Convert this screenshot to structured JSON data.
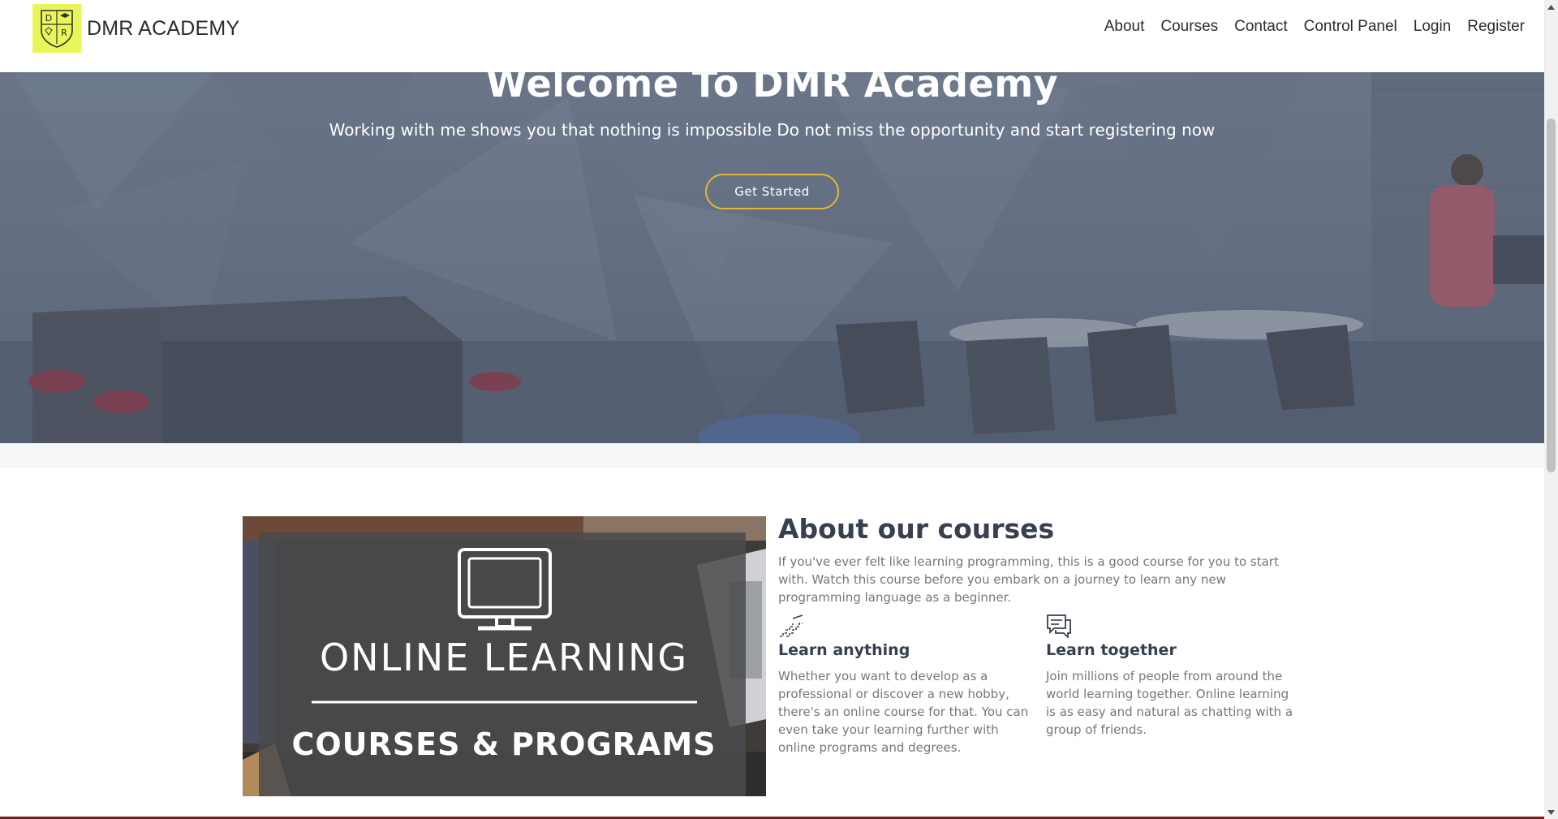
{
  "brand": {
    "name": "DMR ACADEMY",
    "logo_letters": [
      "D",
      "R",
      "A"
    ],
    "logo_caption": "DMR ACADEMY",
    "logo_bg": "#e8f65a"
  },
  "nav": {
    "items": [
      {
        "label": "About"
      },
      {
        "label": "Courses"
      },
      {
        "label": "Contact"
      },
      {
        "label": "Control Panel"
      },
      {
        "label": "Login"
      },
      {
        "label": "Register"
      }
    ]
  },
  "hero": {
    "title": "Welcome To DMR Academy",
    "subtitle": "Working with me shows you that nothing is impossible Do not miss the opportunity and start registering now",
    "button_label": "Get Started",
    "button_border_color": "#e5b732"
  },
  "about": {
    "image": {
      "line1": "ONLINE LEARNING",
      "line2": "COURSES & PROGRAMS",
      "icon": "monitor-icon"
    },
    "title": "About our courses",
    "description": "If you've ever felt like learning programming, this is a good course for you to start with. Watch this course before you embark on a journey to learn any new programming language as a beginner.",
    "features": [
      {
        "icon": "stairs-icon",
        "title": "Learn anything",
        "text": "Whether you want to develop as a professional or discover a new hobby, there's an online course for that. You can even take your learning further with online programs and degrees."
      },
      {
        "icon": "chat-icon",
        "title": "Learn together",
        "text": "Join millions of people from around the world learning together. Online learning is as easy and natural as chatting with a group of friends."
      }
    ]
  },
  "colors": {
    "heading": "#36404f",
    "body_text": "#777777",
    "accent": "#e5b732"
  }
}
